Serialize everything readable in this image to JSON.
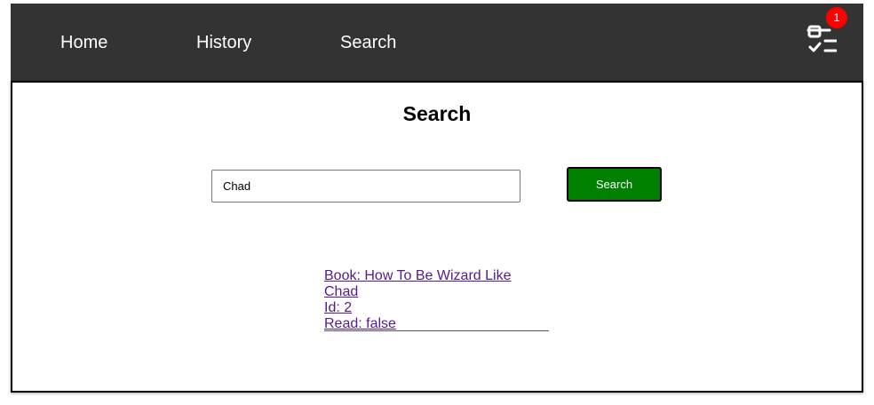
{
  "nav": {
    "home": "Home",
    "history": "History",
    "search": "Search",
    "notification_count": "1",
    "checklist_icon": "checklist-icon",
    "badge_color": "#ff0000",
    "bar_color": "#333333"
  },
  "main": {
    "title": "Search",
    "search_input_value": "Chad",
    "search_button": "Search",
    "button_color": "#008000",
    "results": [
      {
        "book": "Book: How To Be Wizard Like Chad",
        "id": "Id: 2",
        "read": "Read: false"
      }
    ]
  }
}
